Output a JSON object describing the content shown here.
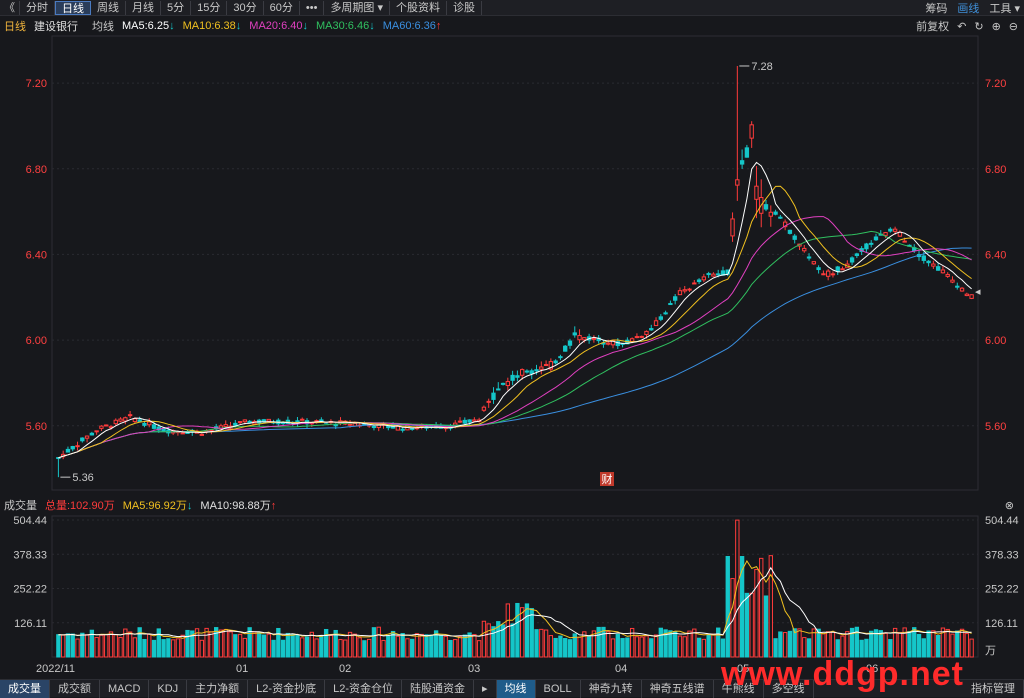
{
  "toolbar": {
    "back": "《",
    "items": [
      "分时",
      "日线",
      "周线",
      "月线",
      "5分",
      "15分",
      "30分",
      "60分",
      "•••",
      "多周期图 ▾",
      "个股资料",
      "诊股"
    ],
    "right": [
      "筹码",
      "画线",
      "工具 ▾"
    ]
  },
  "info": {
    "period": "日线",
    "stock": "建设银行",
    "ma_label": "均线",
    "ma5": "MA5:6.25",
    "ma10": "MA10:6.38",
    "ma20": "MA20:6.40",
    "ma30": "MA30:6.46",
    "ma60": "MA60:6.36",
    "adjust": "前复权"
  },
  "volume_info": {
    "label": "成交量",
    "total": "总量:102.90万",
    "ma5": "MA5:96.92万",
    "ma10": "MA10:98.88万"
  },
  "bottom_tabs": [
    "成交量",
    "成交额",
    "MACD",
    "KDJ",
    "主力净额",
    "L2-资金抄底",
    "L2-资金仓位",
    "陆股通资金"
  ],
  "bottom_tabs2": [
    "均线",
    "BOLL",
    "神奇九转",
    "神奇五线谱",
    "牛熊线",
    "多空线",
    "指标管理"
  ],
  "watermark": "www.ddgp.net",
  "colors": {
    "up": "#ff3b3b",
    "down": "#15c6c9",
    "ma5": "#ffffff",
    "ma10": "#f0c020",
    "ma20": "#e040c0",
    "ma30": "#30c060",
    "ma60": "#3a8fe0"
  },
  "chart_data": {
    "type": "candlestick",
    "price_axis": [
      "7.20",
      "6.80",
      "6.40",
      "6.00",
      "5.60"
    ],
    "volume_axis": [
      "504.44",
      "378.33",
      "252.22",
      "126.11"
    ],
    "volume_unit": "万",
    "x_labels": [
      "2022/11",
      "01",
      "02",
      "03",
      "04",
      "05",
      "06"
    ],
    "max_label": "7.28",
    "min_label": "5.36",
    "event_marker": "财",
    "ylim": [
      5.3,
      7.42
    ]
  }
}
